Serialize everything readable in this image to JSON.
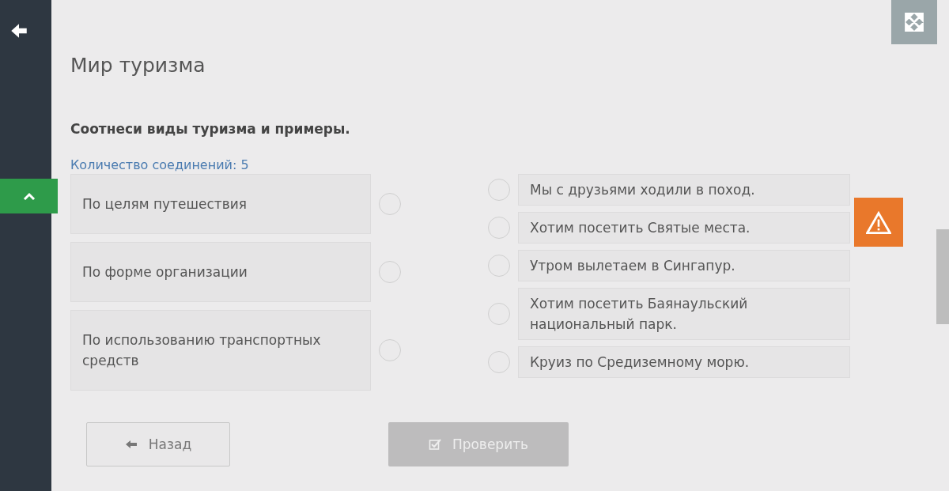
{
  "title": "Мир туризма",
  "instruction": "Соотнеси виды туризма и примеры.",
  "connections": "Количество соединений: 5",
  "left_items": [
    {
      "label": "По целям путешествия"
    },
    {
      "label": "По форме организации"
    },
    {
      "label": "По использованию транспортных средств"
    }
  ],
  "right_items": [
    {
      "label": "Мы с друзьями ходили в поход."
    },
    {
      "label": "Хотим посетить Святые места."
    },
    {
      "label": "Утром вылетаем в Сингапур."
    },
    {
      "label": "Хотим посетить Баянаульский национальный парк."
    },
    {
      "label": "Круиз по Средиземному морю."
    }
  ],
  "buttons": [
    {
      "label": "Назад",
      "disabled": false
    },
    {
      "label": "Проверить",
      "disabled": true
    }
  ]
}
